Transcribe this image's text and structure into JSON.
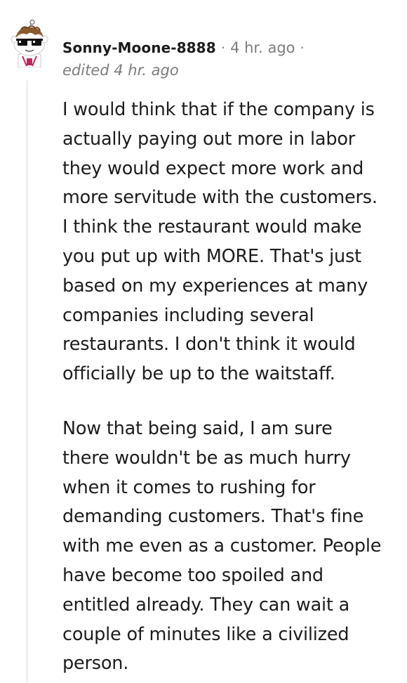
{
  "comment": {
    "author": "Sonny-Moone-8888",
    "separator": "·",
    "timestamp": "4 hr. ago",
    "edited": "edited 4 hr. ago",
    "avatar_icon": "snoo-avatar-with-sunglasses-icon",
    "paragraphs": [
      [
        "I would think that if the company is",
        "actually paying out more in labor",
        "they would expect more work and",
        "more servitude with the customers.",
        "I think the restaurant would make",
        "you put up with MORE. That's just",
        "based on my experiences at many",
        "companies including several",
        "restaurants. I don't think it would",
        "officially be up to the waitstaff."
      ],
      [
        "Now that being said, I am sure",
        "there wouldn't be as much hurry",
        "when it comes to rushing for",
        "demanding customers. That's fine",
        "with me even as a customer. People",
        "have become too spoiled and",
        "entitled already. They can wait a",
        "couple of minutes like a civilized",
        "person."
      ]
    ]
  },
  "colors": {
    "text": "#1c1c1c",
    "meta": "#7c7c7c",
    "thread_line": "#edeff1"
  }
}
